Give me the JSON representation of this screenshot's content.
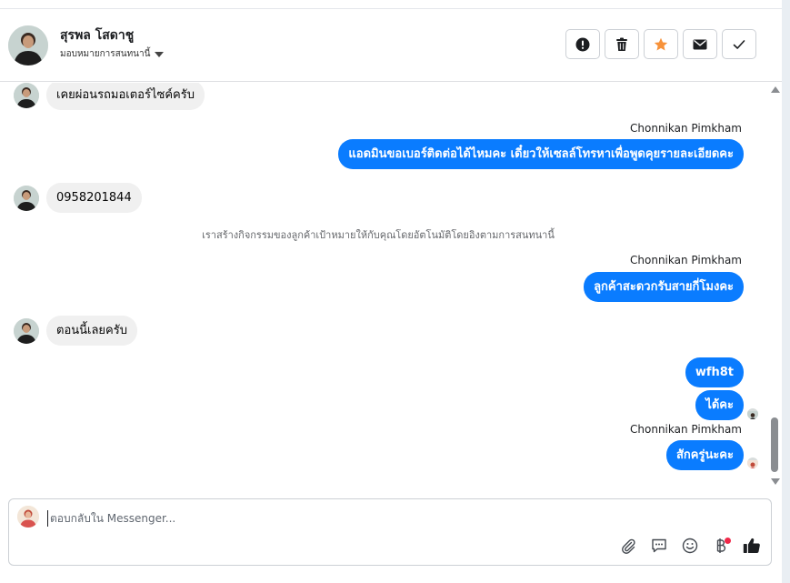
{
  "header": {
    "contact_name": "สุรพล โสดาชู",
    "assign_label": "มอบหมายการสนทนานี้",
    "actions": [
      {
        "name": "spam",
        "icon": "alert-icon"
      },
      {
        "name": "delete",
        "icon": "trash-icon"
      },
      {
        "name": "follow-up",
        "icon": "star-icon",
        "color": "#f7923a"
      },
      {
        "name": "mark-unread",
        "icon": "envelope-icon"
      },
      {
        "name": "mark-done",
        "icon": "check-icon"
      }
    ]
  },
  "thread": {
    "messages": [
      {
        "direction": "in",
        "text": "เคยผ่อนรถมอเตอร์ไซค์ครับ"
      },
      {
        "direction": "out",
        "sender": "Chonnikan Pimkham",
        "text": "แอดมินขอเบอร์ติดต่อได้ไหมคะ เดี๋ยวให้เซลล์โทรหาเพื่อพูดคุยรายละเอียดคะ"
      },
      {
        "direction": "in",
        "text": "0958201844"
      },
      {
        "direction": "system",
        "text": "เราสร้างกิจกรรมของลูกค้าเป้าหมายให้กับคุณโดยอัตโนมัติโดยอิงตามการสนทนานี้"
      },
      {
        "direction": "out",
        "sender": "Chonnikan Pimkham",
        "text": "ลูกค้าสะดวกรับสายกี่โมงคะ"
      },
      {
        "direction": "in",
        "text": "ตอนนี้เลยครับ"
      },
      {
        "direction": "out",
        "text": "wfh8t"
      },
      {
        "direction": "out",
        "text": "ได้คะ"
      },
      {
        "direction": "out",
        "sender": "Chonnikan Pimkham",
        "text": "สักครู่นะคะ"
      }
    ]
  },
  "composer": {
    "placeholder": "ตอบกลับใน Messenger..."
  },
  "colors": {
    "outgoing_bubble": "#0a7cff",
    "incoming_bubble": "#f0f0f0",
    "notification_dot": "#f02849"
  }
}
